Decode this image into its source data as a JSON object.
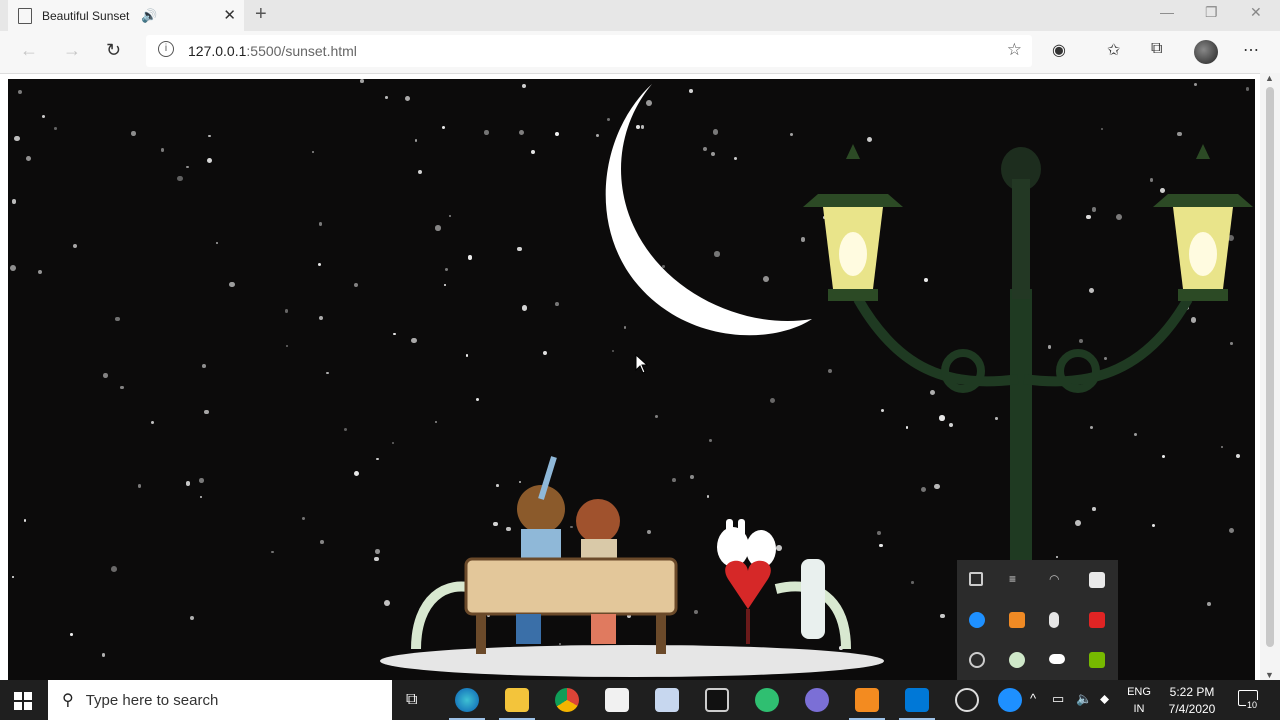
{
  "browser": {
    "tab_title": "Beautiful Sunset",
    "new_tab": "+",
    "url_host": "127.0.0.1",
    "url_rest": ":5500/sunset.html"
  },
  "taskbar": {
    "search_placeholder": "Type here to search",
    "lang_line1": "ENG",
    "lang_line2": "IN",
    "time": "5:22 PM",
    "date": "7/4/2020",
    "notification_count": "10"
  },
  "colors": {
    "page_bg": "#0c0b0b",
    "moon": "#ffffff",
    "taskbar_bg": "#1f1f1f",
    "tray_bg": "#2b2b2b"
  },
  "icons": {
    "back": "arrow-left-icon",
    "forward": "arrow-right-icon",
    "refresh": "refresh-icon",
    "favorite": "star-icon",
    "collections": "collections-icon",
    "more": "more-icon"
  }
}
